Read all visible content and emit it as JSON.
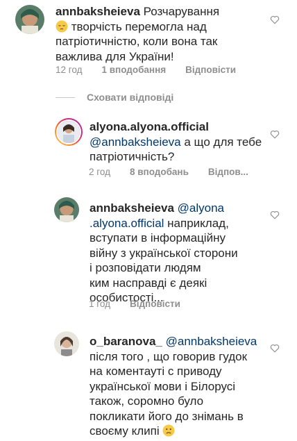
{
  "comments": [
    {
      "username": "annbaksheieva",
      "lines": [
        "Розчарування",
        "творчість перемогла над",
        "патріотичністю, коли вона так",
        "важлива для України!"
      ],
      "emoji": "pensive-face",
      "time": "12 год",
      "likes": "1 вподобання",
      "reply": "Відповісти"
    },
    {
      "username": "alyona.alyona.official",
      "mention": "@annbaksheieva",
      "lines": [
        "а що для тебе",
        "патріотичність?"
      ],
      "time": "2 год",
      "likes": "8 вподобань",
      "reply": "Відпов..."
    },
    {
      "username": "annbaksheieva",
      "mention_a": "@alyona",
      "mention_b": ".alyona.official",
      "lines": [
        "наприклад,",
        "вступати в інформаційну",
        "війну з української сторони",
        "і розповідати людям",
        "ким насправді є деякі",
        "особистості..."
      ],
      "time": "1 год",
      "reply": "Відповісти"
    },
    {
      "username": "o_baranova_",
      "mention": "@annbaksheieva",
      "lines": [
        "після того , що говорив гудок",
        "на коментауті с приводу",
        "української мови і Білорусі",
        "також, соромно було",
        "покликати його до знімань в",
        "своєму клипі"
      ],
      "emoji": "slightly-frowning-face"
    }
  ],
  "hide_replies": "Сховати відповіді",
  "colors": {
    "text": "#262626",
    "meta": "#8e8e8e",
    "mention": "#00376b"
  },
  "icons": [
    "heart-outline-icon"
  ]
}
